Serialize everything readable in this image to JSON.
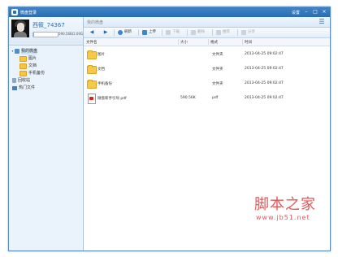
{
  "window": {
    "title": "微盘登录",
    "settings_label": "设置"
  },
  "window_controls": [
    "–",
    "□",
    "×"
  ],
  "profile": {
    "username": "西筱_74367",
    "quota_text": "590.56B/2.00G",
    "quota_fraction": 0.0003
  },
  "tree": [
    {
      "label": "我的微盘",
      "icon": "disk-icon",
      "toggle": "▾",
      "selected": true
    },
    {
      "label": "图片",
      "icon": "folder-icon"
    },
    {
      "label": "文档",
      "icon": "folder-icon"
    },
    {
      "label": "手机备份",
      "icon": "folder-icon"
    },
    {
      "label": "回收站",
      "icon": "recycle-bin-icon"
    },
    {
      "label": "热门文件",
      "icon": "hot-files-icon"
    }
  ],
  "breadcrumb": "我的微盘",
  "toolbar": {
    "back": "◀",
    "forward": "▶",
    "refresh": "刷新",
    "upload": "上传",
    "download": "下载",
    "delete": "删除",
    "share": "推荐",
    "more": "分享"
  },
  "columns": {
    "name": "文件名",
    "size": "大小",
    "type": "格式",
    "time": "时间"
  },
  "files": [
    {
      "name": "图片",
      "size": "",
      "type": "文件夹",
      "time": "2013-04-25 09:02:47",
      "icon": "folder-icon"
    },
    {
      "name": "文档",
      "size": "",
      "type": "文件夹",
      "time": "2013-04-25 09:02:47",
      "icon": "folder-icon"
    },
    {
      "name": "手机备份",
      "size": "",
      "type": "文件夹",
      "time": "2013-04-25 09:02:47",
      "icon": "folder-icon"
    },
    {
      "name": "微盘新手引导.pdf",
      "size": "590.56K",
      "type": "pdf",
      "time": "2013-04-25 09:02:47",
      "icon": "pdf-icon"
    }
  ],
  "watermark": {
    "line1": "脚本之家",
    "line2": "www.jb51.net"
  },
  "colors": {
    "accent": "#2a6cb1",
    "watermark": "#e05858"
  }
}
